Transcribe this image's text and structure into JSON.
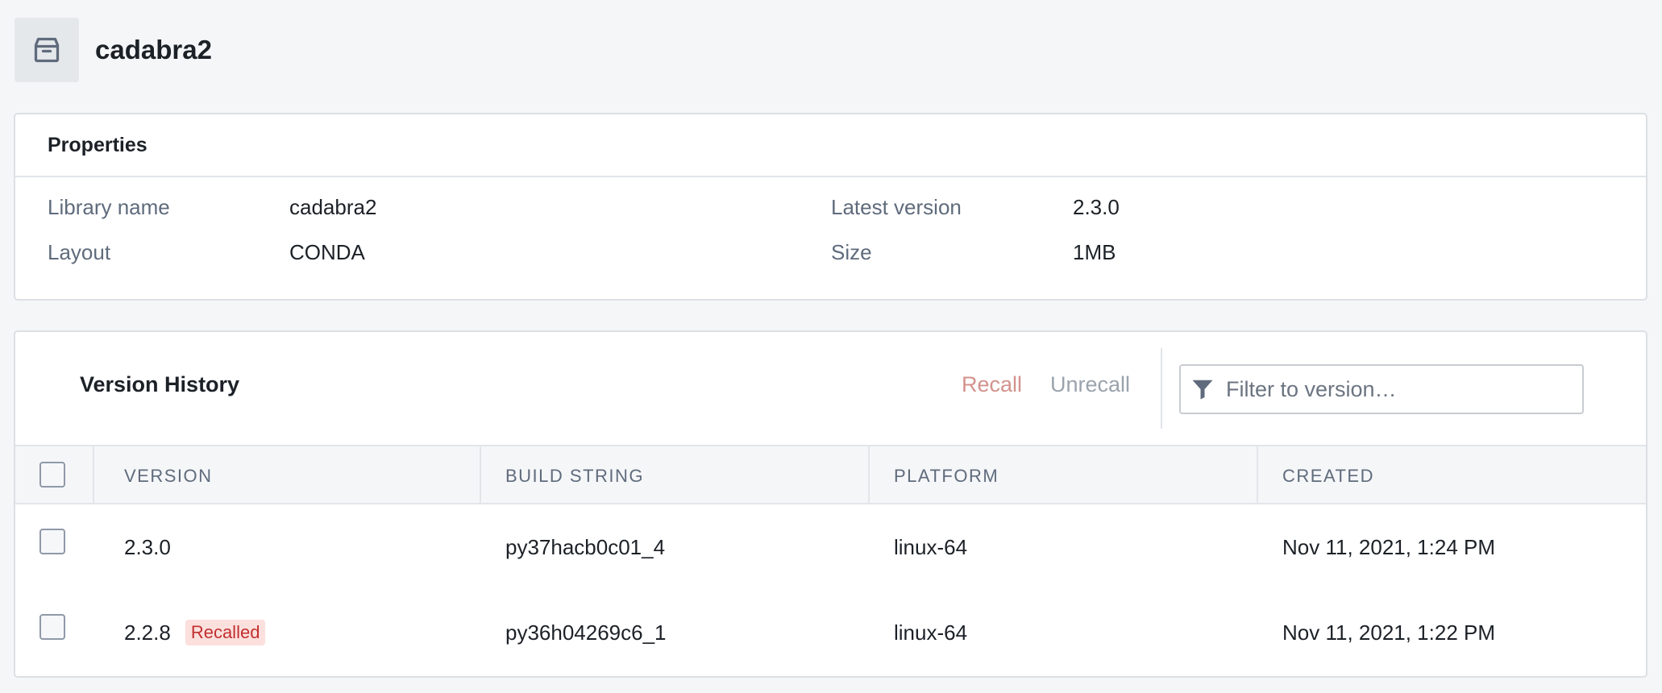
{
  "header": {
    "title": "cadabra2",
    "icon": "package-icon"
  },
  "properties": {
    "title": "Properties",
    "library_name_label": "Library name",
    "library_name_value": "cadabra2",
    "layout_label": "Layout",
    "layout_value": "CONDA",
    "latest_version_label": "Latest version",
    "latest_version_value": "2.3.0",
    "size_label": "Size",
    "size_value": "1MB"
  },
  "version_history": {
    "title": "Version History",
    "recall_label": "Recall",
    "unrecall_label": "Unrecall",
    "filter_placeholder": "Filter to version…",
    "columns": [
      "VERSION",
      "BUILD STRING",
      "PLATFORM",
      "CREATED"
    ],
    "rows": [
      {
        "version": "2.3.0",
        "badge": "",
        "build": "py37hacb0c01_4",
        "platform": "linux-64",
        "created": "Nov 11, 2021, 1:24 PM"
      },
      {
        "version": "2.2.8",
        "badge": "Recalled",
        "build": "py36h04269c6_1",
        "platform": "linux-64",
        "created": "Nov 11, 2021, 1:22 PM"
      }
    ]
  }
}
